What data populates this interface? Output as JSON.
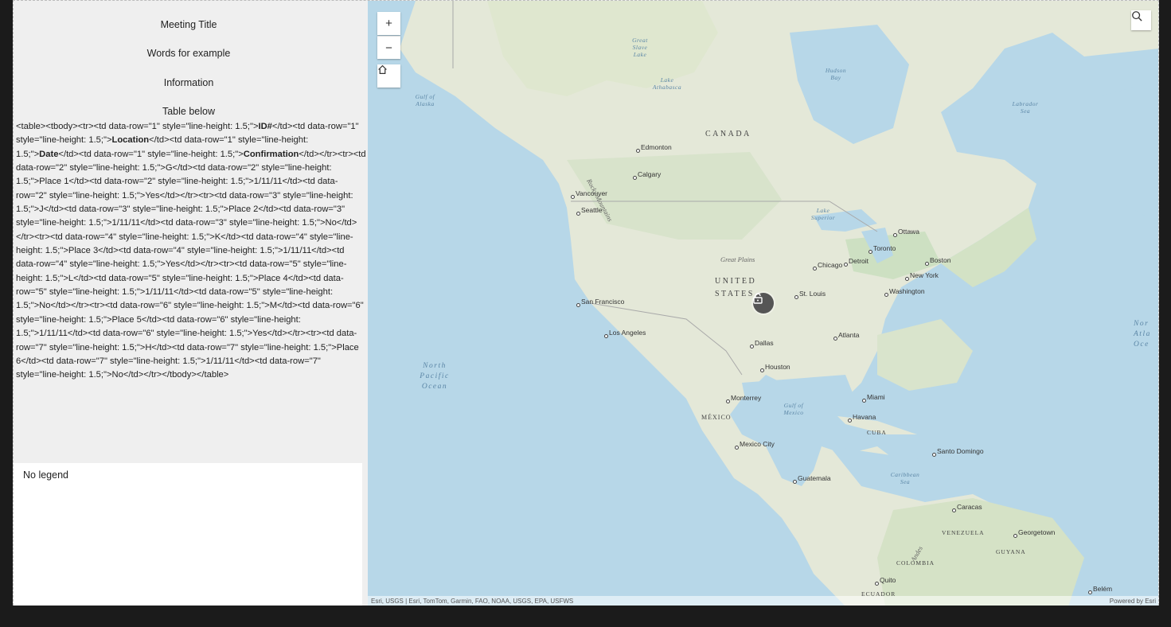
{
  "panel": {
    "meeting_title": "Meeting Title",
    "words": "Words for example",
    "information": "Information",
    "table_label": "Table below",
    "raw_table_segments": [
      {
        "t": "<table><tbody><tr><td data-row=\"1\" style=\"line-height: 1.5;\">",
        "b": false
      },
      {
        "t": "ID#",
        "b": true
      },
      {
        "t": "</td><td data-row=\"1\" style=\"line-height: 1.5;\">",
        "b": false
      },
      {
        "t": "Location",
        "b": true
      },
      {
        "t": "</td><td data-row=\"1\" style=\"line-height: 1.5;\">",
        "b": false
      },
      {
        "t": "Date",
        "b": true
      },
      {
        "t": "</td><td data-row=\"1\" style=\"line-height: 1.5;\">",
        "b": false
      },
      {
        "t": "Confirmation",
        "b": true
      },
      {
        "t": "</td></tr><tr><td data-row=\"2\" style=\"line-height: 1.5;\">G</td><td data-row=\"2\" style=\"line-height: 1.5;\">Place 1</td><td data-row=\"2\" style=\"line-height: 1.5;\">1/11/11</td><td data-row=\"2\" style=\"line-height: 1.5;\">Yes</td></tr><tr><td data-row=\"3\" style=\"line-height: 1.5;\">J</td><td data-row=\"3\" style=\"line-height: 1.5;\">Place 2</td><td data-row=\"3\" style=\"line-height: 1.5;\">1/11/11</td><td data-row=\"3\" style=\"line-height: 1.5;\">No</td></tr><tr><td data-row=\"4\" style=\"line-height: 1.5;\">K</td><td data-row=\"4\" style=\"line-height: 1.5;\">Place 3</td><td data-row=\"4\" style=\"line-height: 1.5;\">1/11/11</td><td data-row=\"4\" style=\"line-height: 1.5;\">Yes</td></tr><tr><td data-row=\"5\" style=\"line-height: 1.5;\">L</td><td data-row=\"5\" style=\"line-height: 1.5;\">Place 4</td><td data-row=\"5\" style=\"line-height: 1.5;\">1/11/11</td><td data-row=\"5\" style=\"line-height: 1.5;\">No</td></tr><tr><td data-row=\"6\" style=\"line-height: 1.5;\">M</td><td data-row=\"6\" style=\"line-height: 1.5;\">Place 5</td><td data-row=\"6\" style=\"line-height: 1.5;\">1/11/11</td><td data-row=\"6\" style=\"line-height: 1.5;\">Yes</td></tr><tr><td data-row=\"7\" style=\"line-height: 1.5;\">H</td><td data-row=\"7\" style=\"line-height: 1.5;\">Place 6</td><td data-row=\"7\" style=\"line-height: 1.5;\">1/11/11</td><td data-row=\"7\" style=\"line-height: 1.5;\">No</td></tr></tbody></table>",
        "b": false
      }
    ],
    "legend_text": "No legend"
  },
  "map": {
    "zoom_in_label": "+",
    "zoom_out_label": "−",
    "home_icon": "home-icon",
    "search_icon": "search-icon",
    "lock_icon": "lock-icon",
    "attribution": "Esri, USGS | Esri, TomTom, Garmin, FAO, NOAA, USGS, EPA, USFWS",
    "powered_by": "Powered by Esri",
    "countries": [
      "CANADA",
      "UNITED",
      "STATES",
      "MÉXICO",
      "CUBA",
      "VENEZUELA",
      "COLOMBIA",
      "GUYANA",
      "ECUADOR"
    ],
    "cities": [
      "Edmonton",
      "Calgary",
      "Vancouver",
      "Seattle",
      "San Francisco",
      "Los Angeles",
      "Dallas",
      "Houston",
      "Monterrey",
      "Mexico City",
      "Guatemala",
      "St. Louis",
      "Chicago",
      "Detroit",
      "Toronto",
      "Ottawa",
      "Boston",
      "New York",
      "Washington",
      "Atlanta",
      "Miami",
      "Havana",
      "Santo Domingo",
      "Caracas",
      "Georgetown",
      "Quito",
      "Belém"
    ],
    "water": [
      "Great Slave Lake",
      "Lake Athabasca",
      "Hudson Bay",
      "Labrador Sea",
      "Gulf of Alaska",
      "Lake Superior",
      "Gulf of Mexico",
      "Caribbean Sea",
      "North Pacific Ocean",
      "Nor Atla Oce"
    ],
    "regions": [
      "Rocky Mountains",
      "Great Plains",
      "Andes"
    ]
  }
}
